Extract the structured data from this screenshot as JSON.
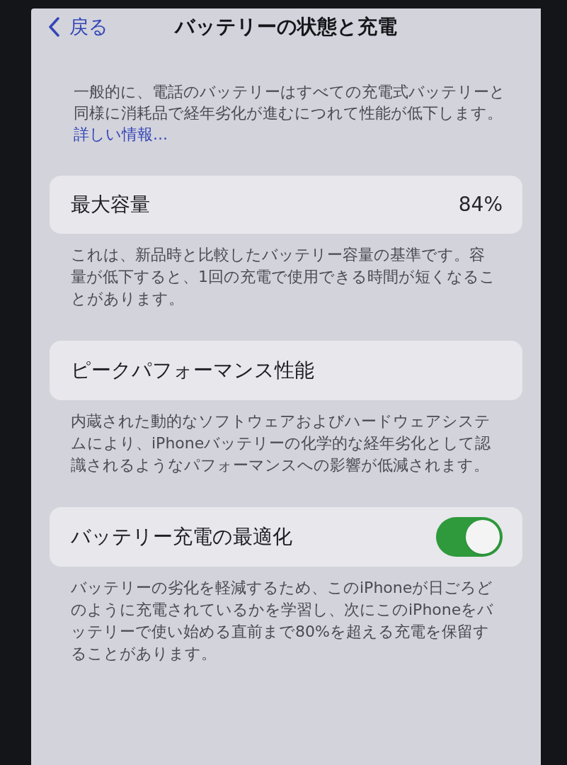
{
  "nav": {
    "back_label": "戻る",
    "title": "バッテリーの状態と充電"
  },
  "intro": {
    "text": "一般的に、電話のバッテリーはすべての充電式バッテリーと同様に消耗品で経年劣化が進むにつれて性能が低下します。",
    "link": "詳しい情報..."
  },
  "sections": [
    {
      "kind": "value",
      "label": "最大容量",
      "value": "84%",
      "description": "これは、新品時と比較したバッテリー容量の基準です。容量が低下すると、1回の充電で使用できる時間が短くなることがあります。"
    },
    {
      "kind": "plain",
      "label": "ピークパフォーマンス性能",
      "description": "内蔵された動的なソフトウェアおよびハードウェアシステムにより、iPhoneバッテリーの化学的な経年劣化として認識されるようなパフォーマンスへの影響が低減されます。"
    },
    {
      "kind": "toggle",
      "label": "バッテリー充電の最適化",
      "on": true,
      "description": "バッテリーの劣化を軽減するため、このiPhoneが日ごろどのように充電されているかを学習し、次にこのiPhoneをバッテリーで使い始める直前まで80%を超える充電を保留することがあります。"
    }
  ]
}
